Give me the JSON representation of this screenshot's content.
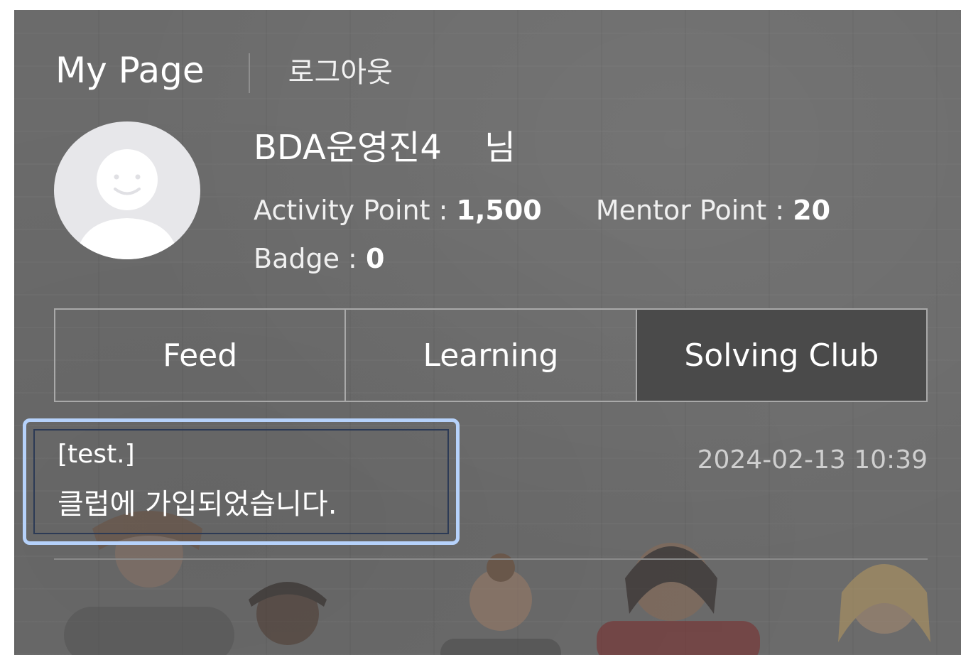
{
  "header": {
    "title": "My Page",
    "logout_label": "로그아웃"
  },
  "profile": {
    "username": "BDA운영진4",
    "honorific": "님",
    "activity_point_label": "Activity Point : ",
    "activity_point_value": "1,500",
    "mentor_point_label": "Mentor Point : ",
    "mentor_point_value": "20",
    "badge_label": "Badge : ",
    "badge_value": "0",
    "avatar_icon": "user-avatar-icon"
  },
  "tabs": [
    {
      "label": "Feed",
      "active": false
    },
    {
      "label": "Learning",
      "active": false
    },
    {
      "label": "Solving Club",
      "active": true
    }
  ],
  "feed": [
    {
      "tag": "[test.]",
      "message": "클럽에 가입되었습니다.",
      "date": "2024-02-13 10:39"
    }
  ],
  "colors": {
    "panel_bg": "#6b6b6b",
    "active_tab_bg": "#4a4a4a",
    "focus_outline": "#b6d2fb",
    "avatar_bg": "#e7e7ea"
  }
}
